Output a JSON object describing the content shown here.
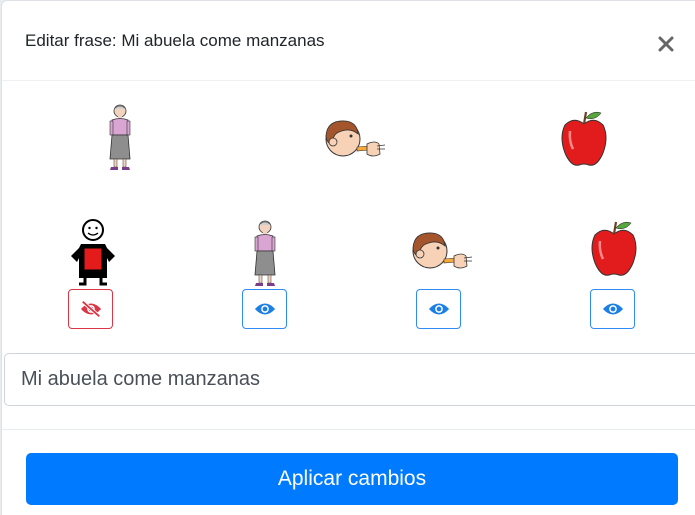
{
  "modal": {
    "title": "Editar frase: Mi abuela come manzanas",
    "close_icon": "times-icon"
  },
  "top_row": [
    {
      "icon": "grandmother-pictogram"
    },
    {
      "icon": "eat-pictogram"
    },
    {
      "icon": "apple-pictogram"
    }
  ],
  "bottom_row": [
    {
      "icon": "me-pictogram",
      "visibility_icon": "eye-slash-icon",
      "visible": false
    },
    {
      "icon": "grandmother-pictogram",
      "visibility_icon": "eye-icon",
      "visible": true
    },
    {
      "icon": "eat-pictogram",
      "visibility_icon": "eye-icon",
      "visible": true
    },
    {
      "icon": "apple-pictogram",
      "visibility_icon": "eye-icon",
      "visible": true
    }
  ],
  "phrase_input": {
    "value": "Mi abuela come manzanas"
  },
  "apply_button": {
    "label": "Aplicar cambios"
  },
  "colors": {
    "primary": "#007bff",
    "danger": "#dc3545",
    "eye": "#1b7fe6"
  }
}
